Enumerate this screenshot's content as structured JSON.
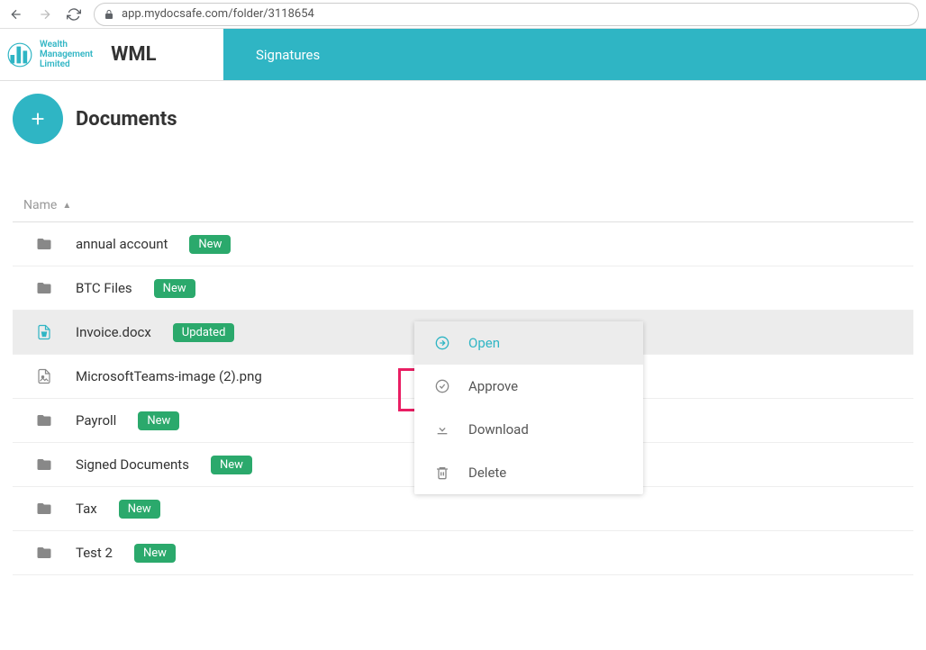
{
  "browser": {
    "url": "app.mydocsafe.com/folder/3118654"
  },
  "header": {
    "logo_lines": [
      "Wealth",
      "Management",
      "Limited"
    ],
    "brand": "WML",
    "nav_tab": "Signatures"
  },
  "page": {
    "title": "Documents",
    "col_name": "Name"
  },
  "rows": [
    {
      "name": "annual account",
      "badge": "New",
      "type": "folder"
    },
    {
      "name": "BTC Files",
      "badge": "New",
      "type": "folder"
    },
    {
      "name": "Invoice.docx",
      "badge": "Updated",
      "type": "word"
    },
    {
      "name": "MicrosoftTeams-image (2).png",
      "badge": "",
      "type": "image"
    },
    {
      "name": "Payroll",
      "badge": "New",
      "type": "folder"
    },
    {
      "name": "Signed Documents",
      "badge": "New",
      "type": "folder"
    },
    {
      "name": "Tax",
      "badge": "New",
      "type": "folder"
    },
    {
      "name": "Test 2",
      "badge": "New",
      "type": "folder"
    }
  ],
  "menu": {
    "open": "Open",
    "approve": "Approve",
    "download": "Download",
    "delete": "Delete"
  }
}
